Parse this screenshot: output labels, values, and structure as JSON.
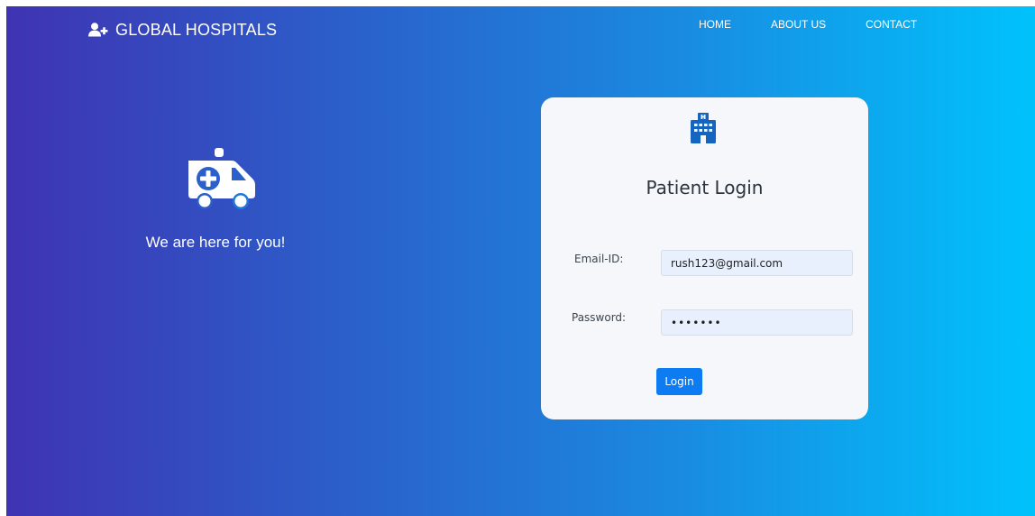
{
  "navbar": {
    "brand_icon": "user-plus-icon",
    "brand_text": "GLOBAL HOSPITALS",
    "links": [
      {
        "label": "HOME"
      },
      {
        "label": "ABOUT US"
      },
      {
        "label": "CONTACT"
      }
    ]
  },
  "hero": {
    "icon": "ambulance-icon",
    "tagline": "We are here for you!"
  },
  "login": {
    "icon": "hospital-building-icon",
    "title": "Patient Login",
    "email_label": "Email-ID:",
    "email_value": "rush123@gmail.com",
    "password_label": "Password:",
    "password_value": "•••••••",
    "button_label": "Login"
  },
  "colors": {
    "gradient_start": "#3f33b3",
    "gradient_end": "#00c2fb",
    "card_background": "#f5f7fa",
    "input_background": "#e8f0fe",
    "button": "#0d7cf2"
  }
}
